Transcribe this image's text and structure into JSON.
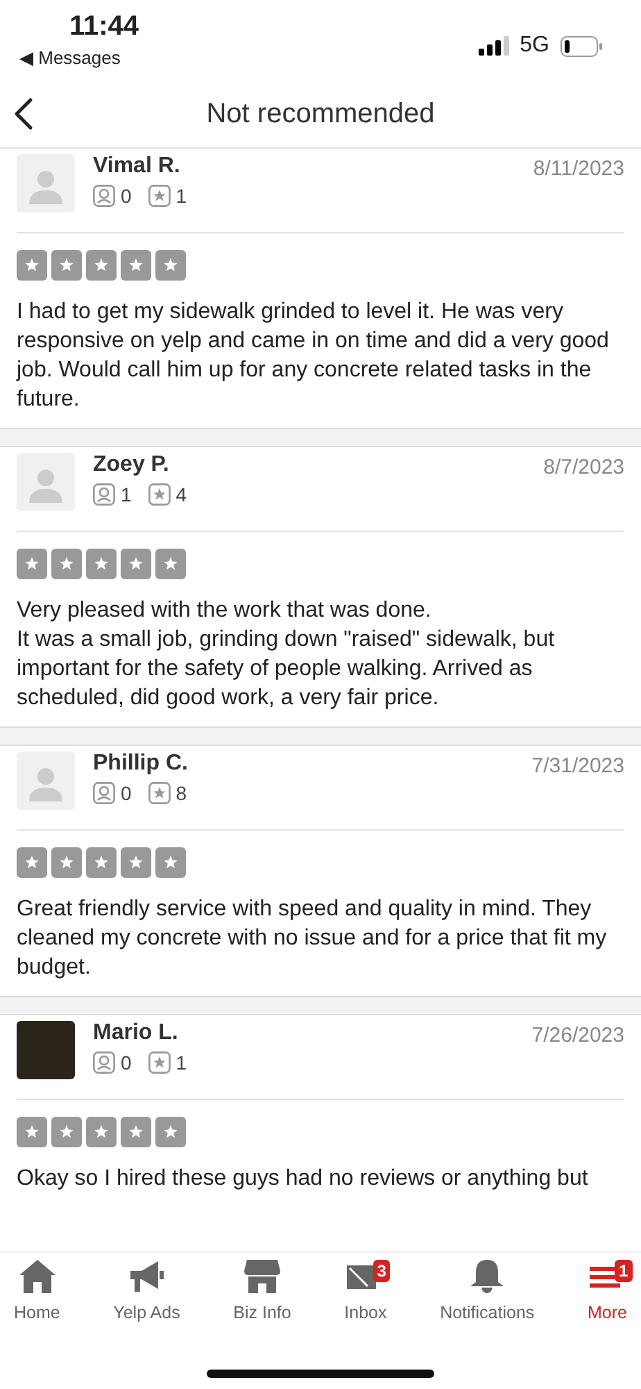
{
  "status_bar": {
    "time": "11:44",
    "back_app": "◀ Messages",
    "network": "5G"
  },
  "header": {
    "title": "Not recommended"
  },
  "reviews": [
    {
      "kind": "default",
      "name": "Vimal R.",
      "date": "8/11/2023",
      "friends": "0",
      "reviews": "1",
      "text": "I had to get my sidewalk grinded to level it. He was very responsive on yelp and came in on time and did a very good job. Would call him up for any concrete related tasks in the future."
    },
    {
      "kind": "default",
      "name": "Zoey P.",
      "date": "8/7/2023",
      "friends": "1",
      "reviews": "4",
      "text": "Very pleased with the work that was done.\nIt was a  small job, grinding down \"raised\" sidewalk, but important for the safety of people walking. Arrived as scheduled, did good work, a very fair price."
    },
    {
      "kind": "default",
      "name": "Phillip C.",
      "date": "7/31/2023",
      "friends": "0",
      "reviews": "8",
      "text": "Great friendly service with speed and quality in mind. They cleaned my concrete with no issue and for a price that fit my budget."
    },
    {
      "kind": "photo",
      "name": "Mario L.",
      "date": "7/26/2023",
      "friends": "0",
      "reviews": "1",
      "text": "Okay so I hired these guys had no reviews or anything but"
    }
  ],
  "tab_bar": [
    {
      "label": "Home",
      "selected": false
    },
    {
      "label": "Yelp Ads",
      "selected": false
    },
    {
      "label": "Biz Info",
      "selected": false
    },
    {
      "label": "Inbox",
      "badge": "3",
      "selected": false
    },
    {
      "label": "Notifications",
      "selected": false
    },
    {
      "label": "More",
      "badge": "1",
      "selected": true
    }
  ]
}
